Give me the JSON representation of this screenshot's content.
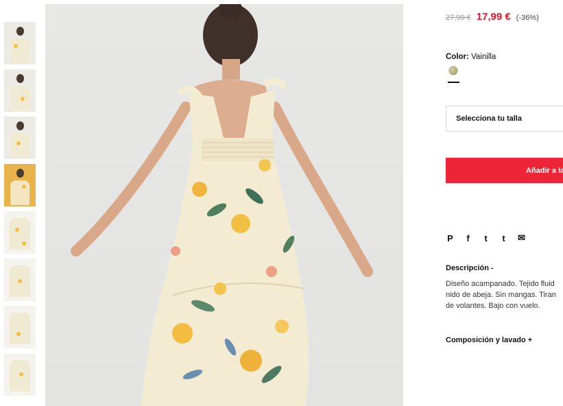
{
  "product": {
    "old_price": "27,99 €",
    "new_price": "17,99 €",
    "discount": "(-36%)",
    "color_label": "Color:",
    "color_value": "Vainilla",
    "size_placeholder": "Selecciona tu talla",
    "add_button": "Añadir a la",
    "description_title": "Descripción -",
    "description_lines": [
      "Diseño acampanado. Tejido fluid",
      "nido de abeja. Sin mangas. Tiran",
      "de volantes. Bajo con vuelo."
    ],
    "composition_title": "Composición y lavado +"
  },
  "share": {
    "pinterest": "P",
    "facebook": "f",
    "twitter": "t",
    "tumblr": "t",
    "email": "✉"
  },
  "thumbnails": [
    {
      "icon": "thumbnail-photo"
    },
    {
      "icon": "thumbnail-photo"
    },
    {
      "icon": "thumbnail-photo"
    },
    {
      "icon": "thumbnail-photo"
    },
    {
      "icon": "thumbnail-photo"
    },
    {
      "icon": "thumbnail-photo"
    },
    {
      "icon": "thumbnail-photo"
    },
    {
      "icon": "thumbnail-photo"
    }
  ],
  "colors": {
    "accent": "#ee2437",
    "sale_price": "#e2182b",
    "dress": "#f3ecd3"
  }
}
